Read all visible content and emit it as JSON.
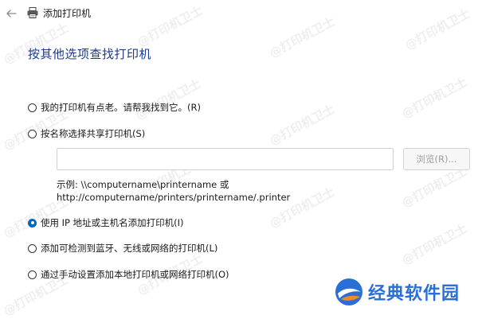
{
  "window": {
    "title": "添加打印机"
  },
  "main": {
    "heading": "按其他选项查找打印机",
    "options": [
      {
        "label": "我的打印机有点老。请帮我找到它。(R)",
        "selected": false
      },
      {
        "label": "按名称选择共享打印机(S)",
        "selected": false
      },
      {
        "label": "使用 IP 地址或主机名添加打印机(I)",
        "selected": true
      },
      {
        "label": "添加可检测到蓝牙、无线或网络的打印机(L)",
        "selected": false
      },
      {
        "label": "通过手动设置添加本地打印机或网络打印机(O)",
        "selected": false
      }
    ],
    "share_input": {
      "value": "",
      "placeholder": ""
    },
    "browse_label": "浏览(R)...",
    "example_line1": "示例: \\\\computername\\printername 或",
    "example_line2": "http://computername/printers/printername/.printer"
  },
  "watermark": {
    "text": "@打印机卫士"
  },
  "brand": {
    "name": "经典软件园"
  },
  "colors": {
    "accent": "#0067c0",
    "heading": "#1f3a8a",
    "brand": "#2a6fd6"
  },
  "icons": {
    "back": "back-arrow-icon",
    "printer": "printer-icon",
    "logo": "brand-logo-icon"
  }
}
